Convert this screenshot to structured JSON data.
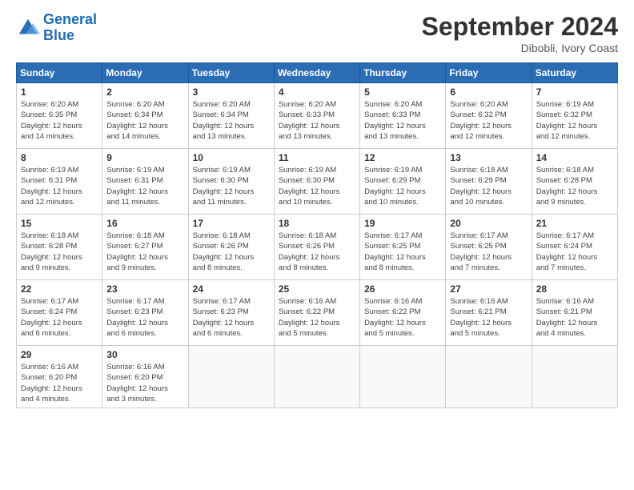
{
  "header": {
    "logo_line1": "General",
    "logo_line2": "Blue",
    "month_title": "September 2024",
    "location": "Dibobli, Ivory Coast"
  },
  "weekdays": [
    "Sunday",
    "Monday",
    "Tuesday",
    "Wednesday",
    "Thursday",
    "Friday",
    "Saturday"
  ],
  "weeks": [
    [
      {
        "day": "1",
        "sunrise": "6:20 AM",
        "sunset": "6:35 PM",
        "daylight": "12 hours and 14 minutes."
      },
      {
        "day": "2",
        "sunrise": "6:20 AM",
        "sunset": "6:34 PM",
        "daylight": "12 hours and 14 minutes."
      },
      {
        "day": "3",
        "sunrise": "6:20 AM",
        "sunset": "6:34 PM",
        "daylight": "12 hours and 13 minutes."
      },
      {
        "day": "4",
        "sunrise": "6:20 AM",
        "sunset": "6:33 PM",
        "daylight": "12 hours and 13 minutes."
      },
      {
        "day": "5",
        "sunrise": "6:20 AM",
        "sunset": "6:33 PM",
        "daylight": "12 hours and 13 minutes."
      },
      {
        "day": "6",
        "sunrise": "6:20 AM",
        "sunset": "6:32 PM",
        "daylight": "12 hours and 12 minutes."
      },
      {
        "day": "7",
        "sunrise": "6:19 AM",
        "sunset": "6:32 PM",
        "daylight": "12 hours and 12 minutes."
      }
    ],
    [
      {
        "day": "8",
        "sunrise": "6:19 AM",
        "sunset": "6:31 PM",
        "daylight": "12 hours and 12 minutes."
      },
      {
        "day": "9",
        "sunrise": "6:19 AM",
        "sunset": "6:31 PM",
        "daylight": "12 hours and 11 minutes."
      },
      {
        "day": "10",
        "sunrise": "6:19 AM",
        "sunset": "6:30 PM",
        "daylight": "12 hours and 11 minutes."
      },
      {
        "day": "11",
        "sunrise": "6:19 AM",
        "sunset": "6:30 PM",
        "daylight": "12 hours and 10 minutes."
      },
      {
        "day": "12",
        "sunrise": "6:19 AM",
        "sunset": "6:29 PM",
        "daylight": "12 hours and 10 minutes."
      },
      {
        "day": "13",
        "sunrise": "6:18 AM",
        "sunset": "6:29 PM",
        "daylight": "12 hours and 10 minutes."
      },
      {
        "day": "14",
        "sunrise": "6:18 AM",
        "sunset": "6:28 PM",
        "daylight": "12 hours and 9 minutes."
      }
    ],
    [
      {
        "day": "15",
        "sunrise": "6:18 AM",
        "sunset": "6:28 PM",
        "daylight": "12 hours and 9 minutes."
      },
      {
        "day": "16",
        "sunrise": "6:18 AM",
        "sunset": "6:27 PM",
        "daylight": "12 hours and 9 minutes."
      },
      {
        "day": "17",
        "sunrise": "6:18 AM",
        "sunset": "6:26 PM",
        "daylight": "12 hours and 8 minutes."
      },
      {
        "day": "18",
        "sunrise": "6:18 AM",
        "sunset": "6:26 PM",
        "daylight": "12 hours and 8 minutes."
      },
      {
        "day": "19",
        "sunrise": "6:17 AM",
        "sunset": "6:25 PM",
        "daylight": "12 hours and 8 minutes."
      },
      {
        "day": "20",
        "sunrise": "6:17 AM",
        "sunset": "6:25 PM",
        "daylight": "12 hours and 7 minutes."
      },
      {
        "day": "21",
        "sunrise": "6:17 AM",
        "sunset": "6:24 PM",
        "daylight": "12 hours and 7 minutes."
      }
    ],
    [
      {
        "day": "22",
        "sunrise": "6:17 AM",
        "sunset": "6:24 PM",
        "daylight": "12 hours and 6 minutes."
      },
      {
        "day": "23",
        "sunrise": "6:17 AM",
        "sunset": "6:23 PM",
        "daylight": "12 hours and 6 minutes."
      },
      {
        "day": "24",
        "sunrise": "6:17 AM",
        "sunset": "6:23 PM",
        "daylight": "12 hours and 6 minutes."
      },
      {
        "day": "25",
        "sunrise": "6:16 AM",
        "sunset": "6:22 PM",
        "daylight": "12 hours and 5 minutes."
      },
      {
        "day": "26",
        "sunrise": "6:16 AM",
        "sunset": "6:22 PM",
        "daylight": "12 hours and 5 minutes."
      },
      {
        "day": "27",
        "sunrise": "6:16 AM",
        "sunset": "6:21 PM",
        "daylight": "12 hours and 5 minutes."
      },
      {
        "day": "28",
        "sunrise": "6:16 AM",
        "sunset": "6:21 PM",
        "daylight": "12 hours and 4 minutes."
      }
    ],
    [
      {
        "day": "29",
        "sunrise": "6:16 AM",
        "sunset": "6:20 PM",
        "daylight": "12 hours and 4 minutes."
      },
      {
        "day": "30",
        "sunrise": "6:16 AM",
        "sunset": "6:20 PM",
        "daylight": "12 hours and 3 minutes."
      },
      null,
      null,
      null,
      null,
      null
    ]
  ]
}
